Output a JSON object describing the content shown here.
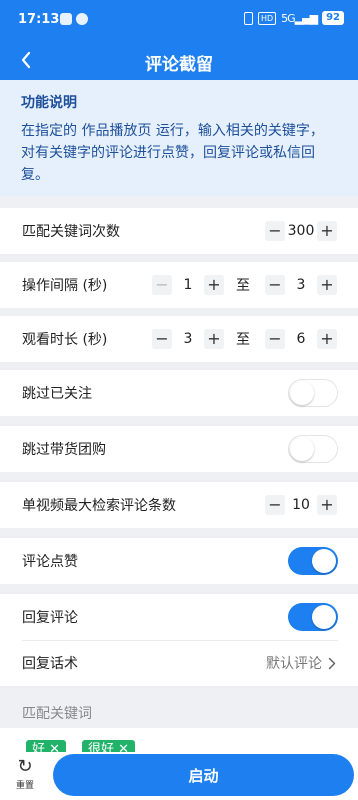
{
  "status": {
    "time": "17:13",
    "hd": "HD",
    "signal": "5G",
    "battery": "92"
  },
  "nav": {
    "back_icon": "chevron-left-icon",
    "title": "评论截留"
  },
  "info": {
    "title": "功能说明",
    "text": "在指定的 作品播放页 运行，输入相关的关键字，对有关键字的评论进行点赞，回复评论或私信回复。"
  },
  "settings": {
    "match_count": {
      "label": "匹配关键词次数",
      "value": "300"
    },
    "interval": {
      "label": "操作间隔 (秒)",
      "min": "1",
      "to": "至",
      "max": "3"
    },
    "watch_time": {
      "label": "观看时长 (秒)",
      "min": "3",
      "to": "至",
      "max": "6"
    },
    "skip_followed": {
      "label": "跳过已关注",
      "on": false
    },
    "skip_group_buy": {
      "label": "跳过带货团购",
      "on": false
    },
    "max_comments": {
      "label": "单视频最大检索评论条数",
      "value": "10"
    },
    "like_comment": {
      "label": "评论点赞",
      "on": true
    },
    "reply_comment": {
      "label": "回复评论",
      "on": true
    },
    "reply_script": {
      "label": "回复话术",
      "value": "默认评论"
    }
  },
  "keywords": {
    "label": "匹配关键词",
    "tags": [
      "好",
      "很好"
    ]
  },
  "bottom": {
    "reset_label": "重置",
    "start_label": "启动"
  },
  "colors": {
    "primary": "#1d7ff0",
    "tag_green": "#21b36a",
    "info_bg": "#e6f0fd"
  }
}
